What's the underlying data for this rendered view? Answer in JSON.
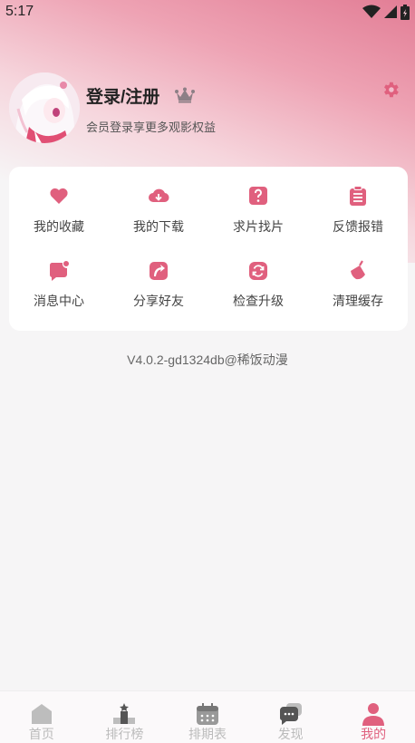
{
  "status_bar": {
    "time": "5:17"
  },
  "profile": {
    "title": "登录/注册",
    "subtitle": "会员登录享更多观影权益"
  },
  "menu": {
    "items": [
      {
        "label": "我的收藏",
        "icon": "heart-icon"
      },
      {
        "label": "我的下载",
        "icon": "cloud-download-icon"
      },
      {
        "label": "求片找片",
        "icon": "question-icon"
      },
      {
        "label": "反馈报错",
        "icon": "clipboard-icon"
      },
      {
        "label": "消息中心",
        "icon": "message-icon"
      },
      {
        "label": "分享好友",
        "icon": "share-icon"
      },
      {
        "label": "检查升级",
        "icon": "refresh-icon"
      },
      {
        "label": "清理缓存",
        "icon": "broom-icon"
      }
    ]
  },
  "version": "V4.0.2-gd1324db@稀饭动漫",
  "bottom_nav": {
    "items": [
      {
        "label": "首页",
        "icon": "home-icon"
      },
      {
        "label": "排行榜",
        "icon": "ranking-icon"
      },
      {
        "label": "排期表",
        "icon": "calendar-icon"
      },
      {
        "label": "发现",
        "icon": "discover-icon"
      },
      {
        "label": "我的",
        "icon": "user-icon"
      }
    ],
    "active_label": "我的"
  },
  "colors": {
    "accent": "#e0607e",
    "inactive": "#bbbbbb"
  }
}
